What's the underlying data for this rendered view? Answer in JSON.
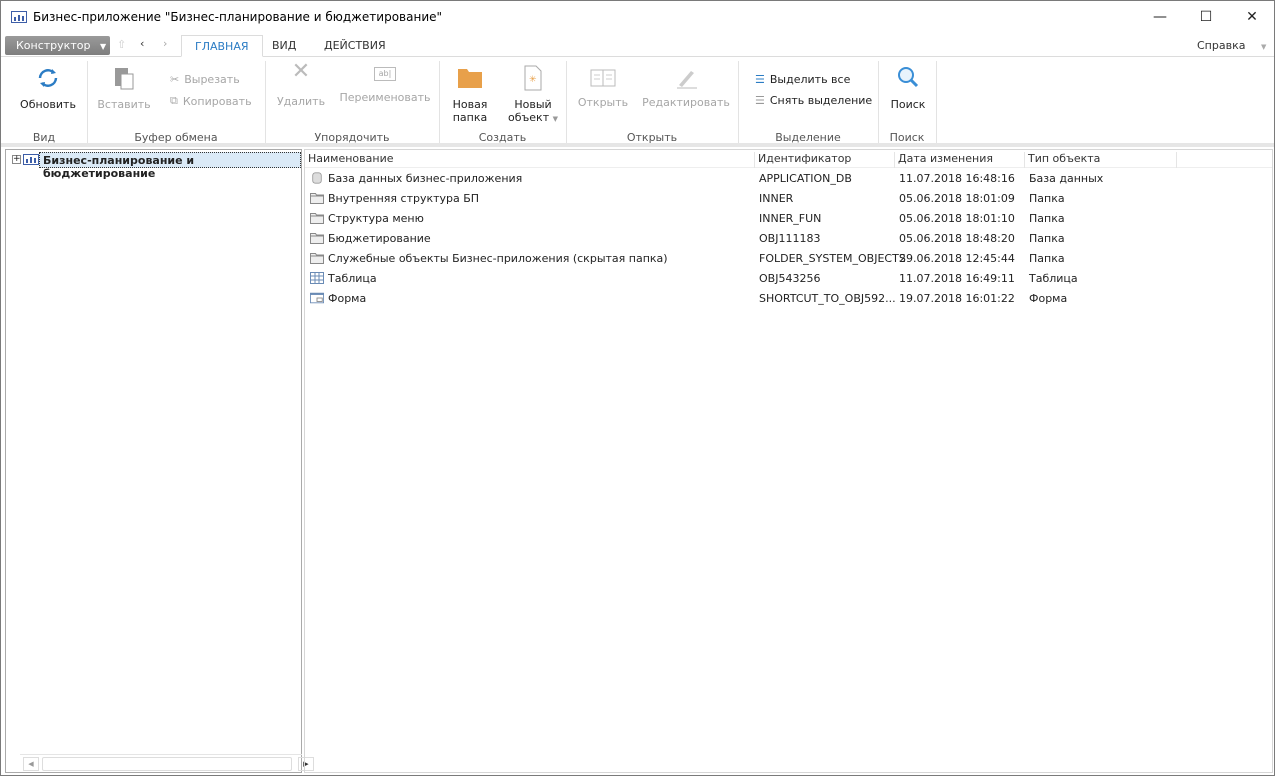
{
  "window": {
    "title": "Бизнес-приложение \"Бизнес-планирование и бюджетирование\"",
    "minimize": "—",
    "maximize": "☐",
    "close": "✕"
  },
  "tabs": {
    "konstruktor": "Конструктор",
    "items": [
      {
        "label": "ГЛАВНАЯ",
        "active": true
      },
      {
        "label": "ВИД"
      },
      {
        "label": "ДЕЙСТВИЯ"
      }
    ],
    "help": "Справка"
  },
  "ribbon": {
    "groups": {
      "view": "Вид",
      "clipboard": "Буфер обмена",
      "arrange": "Упорядочить",
      "create": "Создать",
      "open": "Открыть",
      "selection": "Выделение",
      "search": "Поиск"
    },
    "refresh": "Обновить",
    "paste": "Вставить",
    "cut": "Вырезать",
    "copy": "Копировать",
    "delete": "Удалить",
    "rename": "Переименовать",
    "new_folder_1": "Новая",
    "new_folder_2": "папка",
    "new_object_1": "Новый",
    "new_object_2": "объект",
    "open_btn": "Открыть",
    "edit": "Редактировать",
    "select_all": "Выделить все",
    "deselect": "Снять выделение",
    "search_btn": "Поиск"
  },
  "tree": {
    "root": "Бизнес-планирование и бюджетирование"
  },
  "table": {
    "columns": [
      "Наименование",
      "Идентификатор",
      "Дата изменения",
      "Тип объекта"
    ],
    "rows": [
      {
        "icon": "database",
        "name": "База данных бизнес-приложения",
        "id": "APPLICATION_DB",
        "date": "11.07.2018 16:48:16",
        "type": "База данных"
      },
      {
        "icon": "folder",
        "name": "Внутренняя структура БП",
        "id": "INNER",
        "date": "05.06.2018 18:01:09",
        "type": "Папка"
      },
      {
        "icon": "folder",
        "name": "Структура меню",
        "id": "INNER_FUN",
        "date": "05.06.2018 18:01:10",
        "type": "Папка"
      },
      {
        "icon": "folder",
        "name": "Бюджетирование",
        "id": "OBJ111183",
        "date": "05.06.2018 18:48:20",
        "type": "Папка"
      },
      {
        "icon": "folder",
        "name": "Служебные объекты Бизнес-приложения (скрытая папка)",
        "id": "FOLDER_SYSTEM_OBJECTS",
        "date": "29.06.2018 12:45:44",
        "type": "Папка"
      },
      {
        "icon": "table",
        "name": "Таблица",
        "id": "OBJ543256",
        "date": "11.07.2018 16:49:11",
        "type": "Таблица"
      },
      {
        "icon": "form",
        "name": "Форма",
        "id": "SHORTCUT_TO_OBJ592...",
        "date": "19.07.2018 16:01:22",
        "type": "Форма"
      }
    ]
  },
  "colors": {
    "accent": "#2b7cc4",
    "folder": "#e8a04a"
  }
}
